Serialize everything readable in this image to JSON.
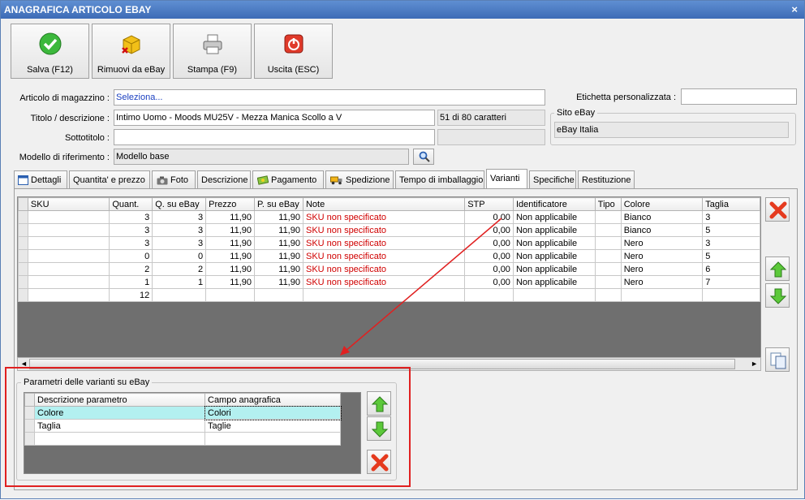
{
  "window": {
    "title": "ANAGRAFICA ARTICOLO EBAY",
    "close": "×"
  },
  "toolbar": {
    "save": "Salva (F12)",
    "remove": "Rimuovi da eBay",
    "print": "Stampa (F9)",
    "exit": "Uscita (ESC)"
  },
  "form": {
    "articolo_label": "Articolo di magazzino :",
    "articolo_value": "Seleziona...",
    "titolo_label": "Titolo / descrizione :",
    "titolo_value": "Intimo Uomo - Moods MU25V - Mezza Manica Scollo a V",
    "char_count": "51 di 80 caratteri",
    "sottotitolo_label": "Sottotitolo :",
    "sottotitolo_value": "",
    "modello_label": "Modello di riferimento :",
    "modello_value": "Modello base",
    "etichetta_label": "Etichetta personalizzata :",
    "etichetta_value": "",
    "sito_label": "Sito eBay",
    "sito_value": "eBay Italia"
  },
  "tabs": [
    "Dettagli",
    "Quantita' e prezzo",
    "Foto",
    "Descrizione",
    "Pagamento",
    "Spedizione",
    "Tempo di imballaggio",
    "Varianti",
    "Specifiche",
    "Restituzione"
  ],
  "active_tab": "Varianti",
  "variants": {
    "columns": [
      "SKU",
      "Quant.",
      "Q. su eBay",
      "Prezzo",
      "P. su eBay",
      "Note",
      "STP",
      "Identificatore",
      "Tipo",
      "Colore",
      "Taglia"
    ],
    "rows": [
      [
        "",
        "3",
        "3",
        "11,90",
        "11,90",
        "SKU non specificato",
        "0,00",
        "Non applicabile",
        "",
        "Bianco",
        "3"
      ],
      [
        "",
        "3",
        "3",
        "11,90",
        "11,90",
        "SKU non specificato",
        "0,00",
        "Non applicabile",
        "",
        "Bianco",
        "5"
      ],
      [
        "",
        "3",
        "3",
        "11,90",
        "11,90",
        "SKU non specificato",
        "0,00",
        "Non applicabile",
        "",
        "Nero",
        "3"
      ],
      [
        "",
        "0",
        "0",
        "11,90",
        "11,90",
        "SKU non specificato",
        "0,00",
        "Non applicabile",
        "",
        "Nero",
        "5"
      ],
      [
        "",
        "2",
        "2",
        "11,90",
        "11,90",
        "SKU non specificato",
        "0,00",
        "Non applicabile",
        "",
        "Nero",
        "6"
      ],
      [
        "",
        "1",
        "1",
        "11,90",
        "11,90",
        "SKU non specificato",
        "0,00",
        "Non applicabile",
        "",
        "Nero",
        "7"
      ]
    ],
    "total": "12"
  },
  "params": {
    "group_title": "Parametri delle varianti su eBay",
    "columns": [
      "Descrizione parametro",
      "Campo anagrafica"
    ],
    "rows": [
      [
        "Colore",
        "Colori"
      ],
      [
        "Taglia",
        "Taglie"
      ]
    ]
  },
  "colors": {
    "accent": "#3d6bb6",
    "note_red": "#d00000",
    "highlight": "#b3f0f0",
    "annotation": "#e02020"
  }
}
